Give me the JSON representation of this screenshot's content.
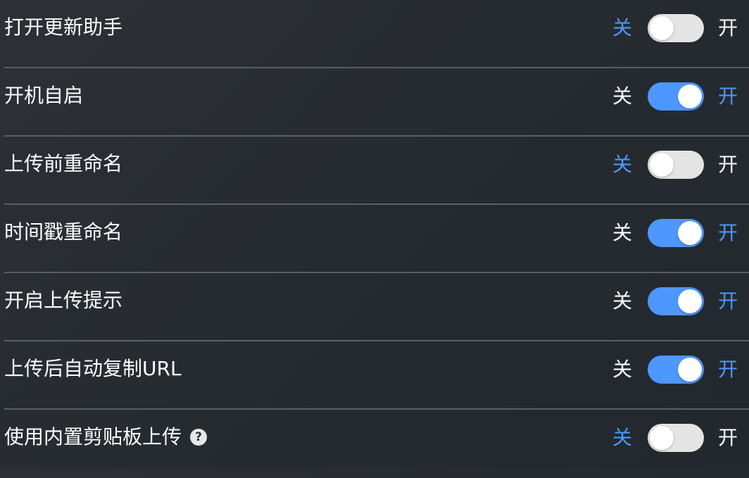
{
  "colors": {
    "accent": "#4d97ff",
    "switch_off": "#e4e4e4",
    "text": "#ffffff",
    "divider": "#5a5f66"
  },
  "settings": [
    {
      "label": "打开更新助手",
      "off_label": "关",
      "on_label": "开",
      "on": false
    },
    {
      "label": "开机自启",
      "off_label": "关",
      "on_label": "开",
      "on": true
    },
    {
      "label": "上传前重命名",
      "off_label": "关",
      "on_label": "开",
      "on": false
    },
    {
      "label": "时间戳重命名",
      "off_label": "关",
      "on_label": "开",
      "on": true
    },
    {
      "label": "开启上传提示",
      "off_label": "关",
      "on_label": "开",
      "on": true
    },
    {
      "label": "上传后自动复制URL",
      "off_label": "关",
      "on_label": "开",
      "on": true
    },
    {
      "label": "使用内置剪贴板上传",
      "off_label": "关",
      "on_label": "开",
      "on": false,
      "help_icon": "question-circle-icon",
      "help_glyph": "?"
    }
  ]
}
